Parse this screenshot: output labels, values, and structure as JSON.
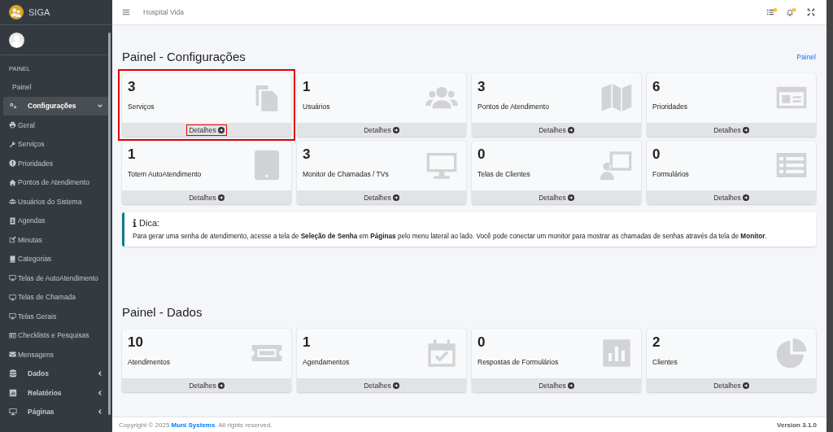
{
  "sidebar": {
    "brand": "SIGA",
    "section": "PAINEL",
    "items": [
      {
        "label": "Painel",
        "kind": "link"
      },
      {
        "label": "Configurações",
        "kind": "group",
        "expanded": true,
        "children": [
          {
            "label": "Geral"
          },
          {
            "label": "Serviços"
          },
          {
            "label": "Prioridades"
          },
          {
            "label": "Pontos de Atendimento"
          },
          {
            "label": "Usuários do Sistema"
          },
          {
            "label": "Agendas"
          },
          {
            "label": "Minutas"
          },
          {
            "label": "Categorias"
          },
          {
            "label": "Telas de AutoAtendimento"
          },
          {
            "label": "Telas de Chamada"
          },
          {
            "label": "Telas Gerais"
          },
          {
            "label": "Checklists e Pesquisas"
          },
          {
            "label": "Mensagens"
          }
        ]
      },
      {
        "label": "Dados",
        "kind": "group",
        "expanded": false
      },
      {
        "label": "Relatórios",
        "kind": "group",
        "expanded": false
      },
      {
        "label": "Páginas",
        "kind": "group",
        "expanded": false
      }
    ]
  },
  "topbar": {
    "title": "Hospital Vida"
  },
  "sections": [
    {
      "title": "Painel - Configurações",
      "breadcrumb": "Painel",
      "cards": [
        {
          "value": "3",
          "label": "Serviços",
          "footer": "Detalhes",
          "highlighted": true
        },
        {
          "value": "1",
          "label": "Usuários",
          "footer": "Detalhes",
          "highlighted": false
        },
        {
          "value": "3",
          "label": "Pontos de Atendimento",
          "footer": "Detalhes",
          "highlighted": false
        },
        {
          "value": "6",
          "label": "Prioridades",
          "footer": "Detalhes",
          "highlighted": false
        },
        {
          "value": "1",
          "label": "Totem AutoAtendimento",
          "footer": "Detalhes",
          "highlighted": false
        },
        {
          "value": "3",
          "label": "Monitor de Chamadas / TVs",
          "footer": "Detalhes",
          "highlighted": false
        },
        {
          "value": "0",
          "label": "Telas de Clientes",
          "footer": "Detalhes",
          "highlighted": false
        },
        {
          "value": "0",
          "label": "Formulários",
          "footer": "Detalhes",
          "highlighted": false
        }
      ],
      "tip": {
        "title": "Dica:",
        "text": "Para gerar uma senha de atendimento, acesse a tela de **Seleção de Senha** em **Páginas** pelo menu lateral ao lado. Você pode conectar um monitor para mostrar as chamadas de senhas através da tela de **Monitor**."
      }
    },
    {
      "title": "Painel - Dados",
      "cards": [
        {
          "value": "10",
          "label": "Atendimentos",
          "footer": "Detalhes",
          "highlighted": false
        },
        {
          "value": "1",
          "label": "Agendamentos",
          "footer": "Detalhes",
          "highlighted": false
        },
        {
          "value": "0",
          "label": "Respostas de Formulários",
          "footer": "Detalhes",
          "highlighted": false
        },
        {
          "value": "2",
          "label": "Clientes",
          "footer": "Detalhes",
          "highlighted": false
        }
      ]
    }
  ],
  "footer": {
    "copyright": "Copyright © 2025 **Muni Systems**. All rights reserved.",
    "version": "Version 3.1.0"
  }
}
